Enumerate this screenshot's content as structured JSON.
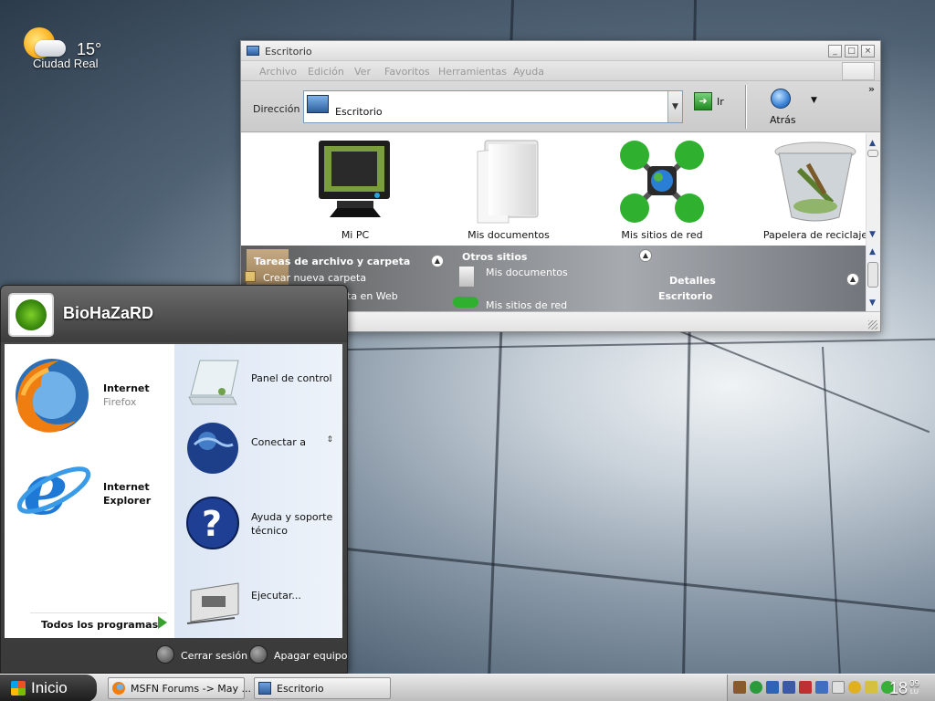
{
  "weather": {
    "temperature": "15°",
    "city": "Ciudad Real",
    "icon": "partly-cloudy-icon"
  },
  "explorer": {
    "title": "Escritorio",
    "menu": [
      "Archivo",
      "Edición",
      "Ver",
      "Favoritos",
      "Herramientas",
      "Ayuda"
    ],
    "address": {
      "label": "Dirección",
      "value": "Escritorio",
      "go_label": "Ir"
    },
    "back_label": "Atrás",
    "items": [
      {
        "label": "Mi PC",
        "icon": "computer-icon"
      },
      {
        "label": "Mis documentos",
        "icon": "documents-folder-icon"
      },
      {
        "label": "Mis sitios de red",
        "icon": "network-icon"
      },
      {
        "label": "Papelera de reciclaje",
        "icon": "recycle-bin-icon"
      }
    ],
    "tasks": {
      "file_tasks_title": "Tareas de archivo y carpeta",
      "new_folder": "Crear nueva carpeta",
      "publish_partial": "ta en Web",
      "other_places_title": "Otros sitios",
      "other_places": [
        "Mis documentos",
        "Mis sitios de red"
      ],
      "details_title": "Detalles",
      "details_value": "Escritorio"
    }
  },
  "startmenu": {
    "username": "BioHaZaRD",
    "pinned": [
      {
        "name": "Internet",
        "sub": "Firefox",
        "icon": "firefox-icon"
      },
      {
        "name": "Internet",
        "sub": "Explorer",
        "icon": "internet-explorer-icon"
      }
    ],
    "all_programs": "Todos los programas",
    "right": [
      {
        "label": "Panel de control",
        "icon": "control-panel-icon"
      },
      {
        "label": "Conectar a",
        "icon": "globe-icon"
      },
      {
        "label": "Ayuda y soporte técnico",
        "icon": "help-icon"
      },
      {
        "label": "Ejecutar...",
        "icon": "run-icon"
      }
    ],
    "logoff": "Cerrar sesión",
    "shutdown": "Apagar equipo"
  },
  "taskbar": {
    "start_label": "Inicio",
    "tasks": [
      {
        "label": "MSFN Forums -> May ...",
        "icon": "firefox-icon"
      },
      {
        "label": "Escritorio",
        "icon": "folder-window-icon"
      }
    ],
    "clock": {
      "hour": "18",
      "minute": "09",
      "day": "LU"
    }
  },
  "colors": {
    "accent_green": "#36a12d",
    "menu_blue": "#1d4f92"
  }
}
